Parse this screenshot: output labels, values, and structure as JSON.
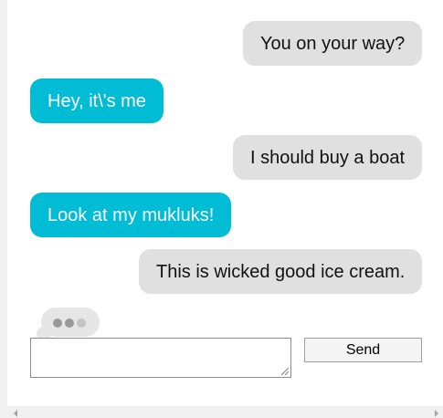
{
  "colors": {
    "outgoing_bubble": "#00bcd4",
    "incoming_bubble": "#e0e0e0",
    "typing_dot_dark": "#999999",
    "typing_dot_light": "#c4c4c4"
  },
  "messages": [
    {
      "sender": "them",
      "text": "You on your way?"
    },
    {
      "sender": "me",
      "text": "Hey, it\\'s me"
    },
    {
      "sender": "them",
      "text": "I should buy a boat"
    },
    {
      "sender": "me",
      "text": "Look at my mukluks!"
    },
    {
      "sender": "them",
      "text": "This is wicked good ice cream."
    }
  ],
  "typing_indicator": {
    "icon": "typing-dots-icon"
  },
  "composer": {
    "input_value": "",
    "send_label": "Send"
  },
  "scrollbar": {
    "left_icon": "scroll-left-arrow-icon",
    "right_icon": "scroll-right-arrow-icon"
  }
}
